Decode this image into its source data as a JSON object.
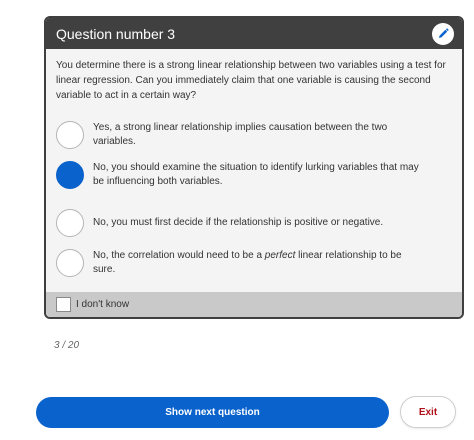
{
  "header": {
    "title": "Question number 3",
    "edit_icon": "pencil-icon"
  },
  "question": {
    "text": "You determine there is a strong linear relationship between two variables using a test for linear regression. Can you immediately claim that one variable is causing the second variable to act in a certain way?"
  },
  "options": [
    {
      "label": "Yes, a strong linear relationship implies causation between the two variables.",
      "selected": false
    },
    {
      "label": "No, you should examine the situation to identify lurking variables that may be influencing both variables.",
      "selected": true
    },
    {
      "label": "No, you must first decide if the relationship is positive or negative.",
      "selected": false
    },
    {
      "label_before": "No, the correlation would need to be a ",
      "label_emphasis": "perfect",
      "label_after": " linear relationship to be sure.",
      "selected": false
    }
  ],
  "dont_know": {
    "label": "I don't know",
    "checked": false
  },
  "progress": {
    "text": "3 / 20"
  },
  "actions": {
    "primary_label": "Show next question",
    "exit_label": "Exit"
  },
  "colors": {
    "accent": "#0a62cc",
    "header_bg": "#404040",
    "exit_text": "#b0121b"
  }
}
